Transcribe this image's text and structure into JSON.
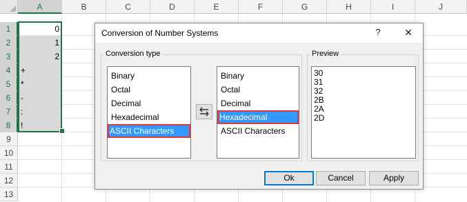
{
  "spreadsheet": {
    "columns": [
      "A",
      "B",
      "C",
      "D",
      "E",
      "F",
      "G",
      "H",
      "I",
      "J"
    ],
    "rows": [
      "1",
      "2",
      "3",
      "4",
      "5",
      "6",
      "7",
      "8",
      "9",
      "10",
      "11",
      "12",
      "13"
    ],
    "cells_a": [
      "0",
      "1",
      "2",
      "+",
      "*",
      "-",
      ":",
      "!"
    ],
    "selected_color": "#217346"
  },
  "dialog": {
    "title": "Conversion of Number Systems",
    "help_label": "?",
    "close_label": "✕",
    "conversion_type_label": "Conversion type",
    "from_list": [
      "Binary",
      "Octal",
      "Decimal",
      "Hexadecimal",
      "ASCII Characters"
    ],
    "from_selected": "ASCII Characters",
    "to_list": [
      "Binary",
      "Octal",
      "Decimal",
      "Hexadecimal",
      "ASCII Characters"
    ],
    "to_selected": "Hexadecimal",
    "swap_icon": "swap-arrows-icon",
    "preview_label": "Preview",
    "preview_values": [
      "30",
      "31",
      "32",
      "2B",
      "2A",
      "2D"
    ],
    "buttons": {
      "ok": "Ok",
      "cancel": "Cancel",
      "apply": "Apply"
    },
    "highlight_color": "#3399ff",
    "highlight_outline_color": "#e2363c"
  }
}
